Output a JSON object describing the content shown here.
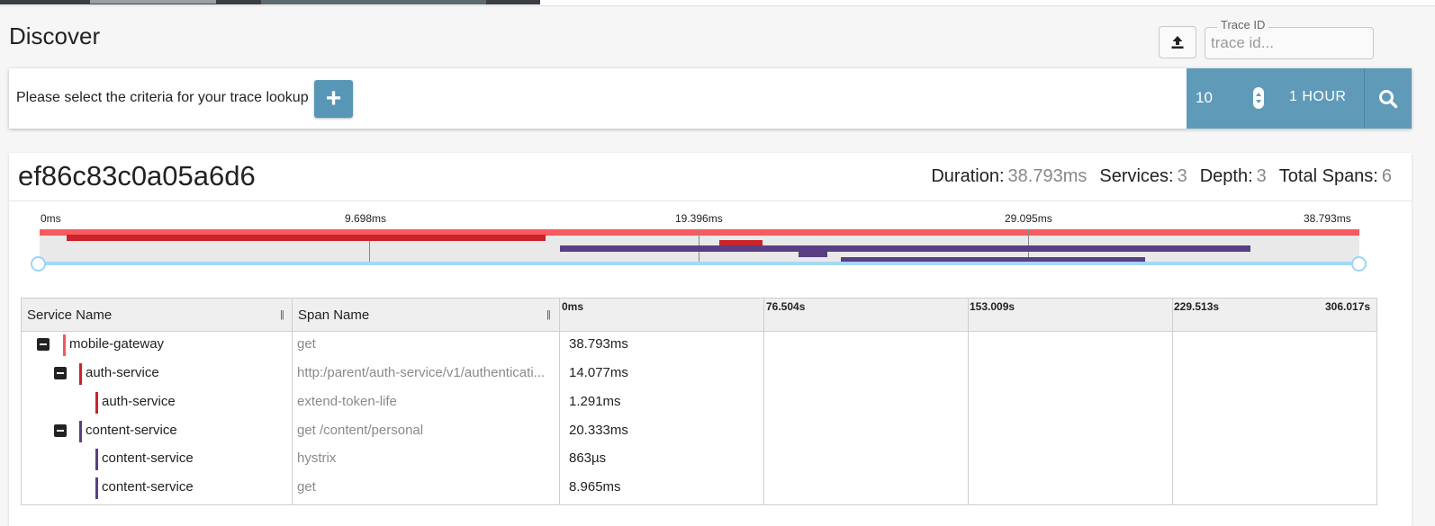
{
  "page": {
    "title": "Discover"
  },
  "trace_lookup": {
    "label": "Trace ID",
    "placeholder": "trace id..."
  },
  "criteria": {
    "prompt": "Please select the criteria for your trace lookup",
    "add_label": "+",
    "limit": "10",
    "time_range": "1 HOUR"
  },
  "trace": {
    "id": "ef86c83c0a05a6d6",
    "stats": {
      "duration_label": "Duration:",
      "duration": "38.793ms",
      "services_label": "Services:",
      "services": "3",
      "depth_label": "Depth:",
      "depth": "3",
      "spans_label": "Total Spans:",
      "spans": "6"
    },
    "minimap_ticks": [
      "0ms",
      "9.698ms",
      "19.396ms",
      "29.095ms",
      "38.793ms"
    ]
  },
  "table": {
    "headers": {
      "service": "Service Name",
      "span": "Span Name"
    },
    "timeline_ticks": [
      "0ms",
      "76.504s",
      "153.009s",
      "229.513s",
      "306.017s"
    ],
    "rows": [
      {
        "service": "mobile-gateway",
        "span": "get",
        "duration": "38.793ms",
        "color": "#f0595e",
        "collapsible": true
      },
      {
        "service": "auth-service",
        "span": "http:/parent/auth-service/v1/authenticati...",
        "duration": "14.077ms",
        "color": "#cc2229",
        "collapsible": true
      },
      {
        "service": "auth-service",
        "span": "extend-token-life",
        "duration": "1.291ms",
        "color": "#cc2229",
        "collapsible": false
      },
      {
        "service": "content-service",
        "span": "get /content/personal",
        "duration": "20.333ms",
        "color": "#5a3f84",
        "collapsible": true
      },
      {
        "service": "content-service",
        "span": "hystrix",
        "duration": "863µs",
        "color": "#5a3f84",
        "collapsible": false
      },
      {
        "service": "content-service",
        "span": "get",
        "duration": "8.965ms",
        "color": "#5a3f84",
        "collapsible": false
      }
    ]
  },
  "colors": {
    "accent": "#5f9bb8",
    "gateway": "#f0595e",
    "auth": "#cc2229",
    "content": "#5a3f84",
    "rail": "#a5d8f5"
  }
}
